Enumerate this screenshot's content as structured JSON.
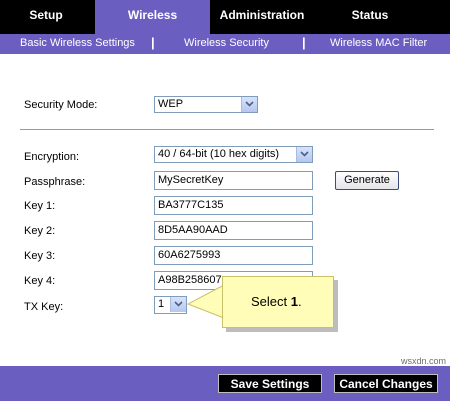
{
  "tabs": [
    {
      "label": "Setup"
    },
    {
      "label": "Wireless"
    },
    {
      "label": "Administration"
    },
    {
      "label": "Status"
    }
  ],
  "subnav": {
    "items": [
      "Basic Wireless Settings",
      "Wireless Security",
      "Wireless MAC Filter"
    ],
    "separator": "|"
  },
  "security_mode": {
    "label": "Security Mode:",
    "value": "WEP"
  },
  "encryption": {
    "label": "Encryption:",
    "value": "40 / 64-bit (10 hex digits)"
  },
  "passphrase": {
    "label": "Passphrase:",
    "value": "MySecretKey",
    "generate_label": "Generate"
  },
  "keys": [
    {
      "label": "Key 1:",
      "value": "BA3777C135"
    },
    {
      "label": "Key 2:",
      "value": "8D5AA90AAD"
    },
    {
      "label": "Key 3:",
      "value": "60A6275993"
    },
    {
      "label": "Key 4:",
      "value": "A98B258607"
    }
  ],
  "tx_key": {
    "label": "TX Key:",
    "value": "1"
  },
  "callout": {
    "text": "Select",
    "bold": "1",
    "suffix": "."
  },
  "footer": {
    "save_label": "Save Settings",
    "cancel_label": "Cancel Changes"
  },
  "watermark": "wsxdn.com",
  "colors": {
    "accent": "#6a5fc1",
    "tab_bar": "#000000",
    "callout_bg": "#fffdb8"
  }
}
